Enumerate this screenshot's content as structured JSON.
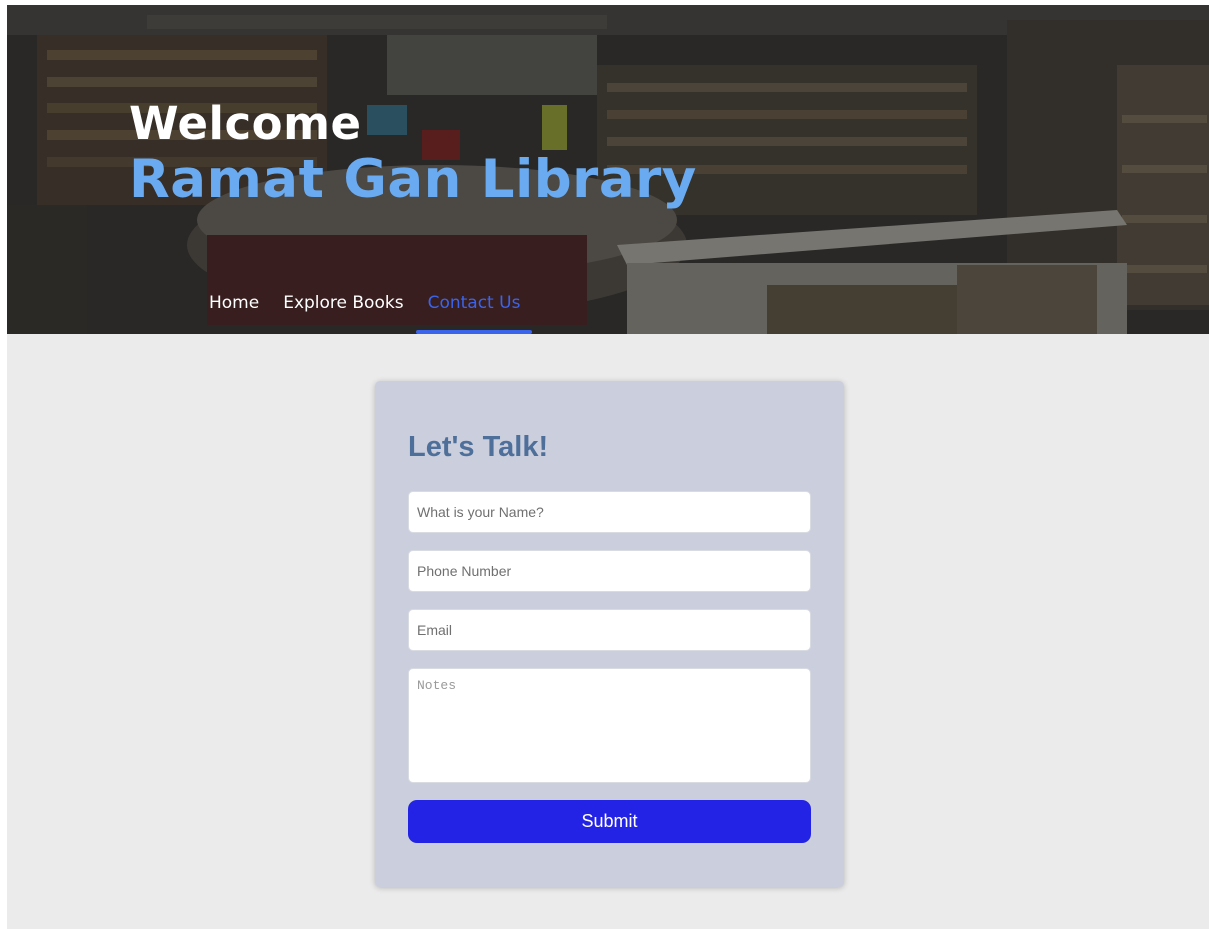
{
  "hero": {
    "welcome": "Welcome",
    "library_name": "Ramat Gan Library"
  },
  "nav": {
    "items": [
      {
        "label": "Home",
        "active": false
      },
      {
        "label": "Explore Books",
        "active": false
      },
      {
        "label": "Contact Us",
        "active": true
      }
    ]
  },
  "contact_form": {
    "title": "Let's Talk!",
    "name_placeholder": "What is your Name?",
    "phone_placeholder": "Phone Number",
    "email_placeholder": "Email",
    "notes_placeholder": "Notes",
    "submit_label": "Submit"
  },
  "colors": {
    "accent_blue": "#3b64ec",
    "title_blue": "#6aaaf0",
    "submit_blue": "#2323e5",
    "card_bg": "#cbcfdd",
    "page_bg": "#ebebeb"
  }
}
